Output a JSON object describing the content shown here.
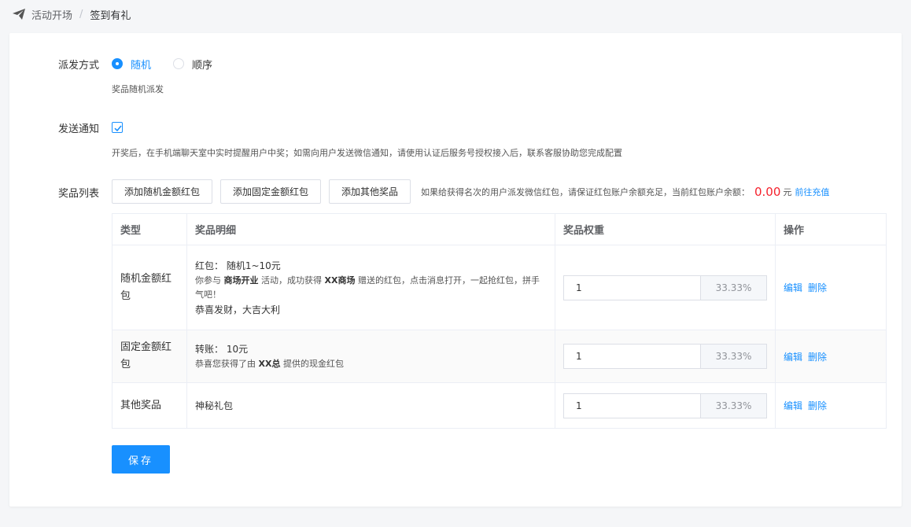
{
  "breadcrumb": {
    "parent": "活动开场",
    "separator": "/",
    "current": "签到有礼"
  },
  "dispatch": {
    "label": "派发方式",
    "options": [
      {
        "label": "随机",
        "selected": true
      },
      {
        "label": "顺序",
        "selected": false
      }
    ],
    "help": "奖品随机派发"
  },
  "notify": {
    "label": "发送通知",
    "checked": true,
    "help": "开奖后，在手机端聊天室中实时提醒用户中奖；如需向用户发送微信通知，请使用认证后服务号授权接入后，联系客服协助您完成配置"
  },
  "prizes": {
    "label": "奖品列表",
    "buttons": [
      "添加随机金额红包",
      "添加固定金额红包",
      "添加其他奖品"
    ],
    "note": "如果给获得名次的用户派发微信红包，请保证红包账户余额充足，当前红包账户余额：",
    "balance": "0.00",
    "unit": "元",
    "recharge": "前往充值",
    "columns": [
      "类型",
      "奖品明细",
      "奖品权重",
      "操作"
    ],
    "rows": [
      {
        "type": "随机金额红包",
        "title": "红包：  随机1~10元",
        "desc_parts": [
          "你参与 ",
          "商场开业",
          " 活动，成功获得 ",
          "XX商场",
          " 赠送的红包，点击消息打开，一起抢红包，拼手气吧！"
        ],
        "wish": "恭喜发财，大吉大利",
        "weight": "1",
        "percent": "33.33%"
      },
      {
        "type": "固定金额红包",
        "title": "转账：  10元",
        "desc_parts": [
          "恭喜您获得了由 ",
          "XX总",
          " 提供的现金红包"
        ],
        "weight": "1",
        "percent": "33.33%"
      },
      {
        "type": "其他奖品",
        "title": "神秘礼包",
        "weight": "1",
        "percent": "33.33%"
      }
    ],
    "ops": {
      "edit": "编辑",
      "delete": "删除"
    }
  },
  "save_label": "保存",
  "colors": {
    "primary": "#1890ff",
    "danger": "#f5222d",
    "border": "#dcdfe6"
  }
}
